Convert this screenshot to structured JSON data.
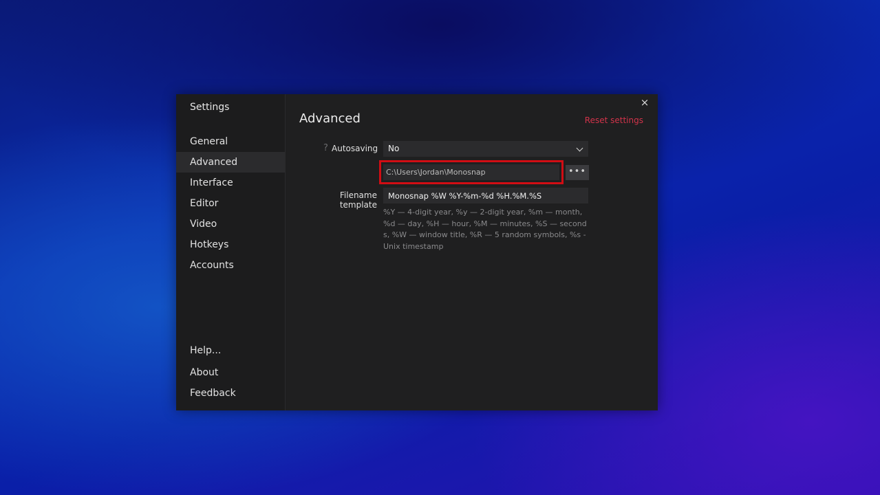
{
  "sidebar": {
    "title": "Settings",
    "items": [
      {
        "label": "General",
        "active": false
      },
      {
        "label": "Advanced",
        "active": true
      },
      {
        "label": "Interface",
        "active": false
      },
      {
        "label": "Editor",
        "active": false
      },
      {
        "label": "Video",
        "active": false
      },
      {
        "label": "Hotkeys",
        "active": false
      },
      {
        "label": "Accounts",
        "active": false
      }
    ],
    "bottom_items": [
      {
        "label": "Help..."
      },
      {
        "label": "About"
      },
      {
        "label": "Feedback"
      }
    ]
  },
  "window": {
    "close_glyph": "×"
  },
  "main": {
    "title": "Advanced",
    "reset_label": "Reset settings",
    "autosaving": {
      "help_glyph": "?",
      "label": "Autosaving",
      "value": "No"
    },
    "folder": {
      "path": "C:\\Users\\Jordan\\Monosnap",
      "browse_label": "•••"
    },
    "filename_template": {
      "label": "Filename template",
      "value": "Monosnap %W %Y-%m-%d %H.%M.%S",
      "hint": "%Y — 4-digit year, %y — 2-digit year, %m — month, %d — day, %H — hour, %M — minutes, %S — seconds, %W — window title, %R — 5 random symbols, %s - Unix timestamp"
    }
  },
  "colors": {
    "window_bg": "#1f1f20",
    "sidebar_bg": "#1c1c1d",
    "active_item_bg": "#2b2b2d",
    "reset_link": "#d2334a",
    "highlight_border": "#d10d14"
  }
}
